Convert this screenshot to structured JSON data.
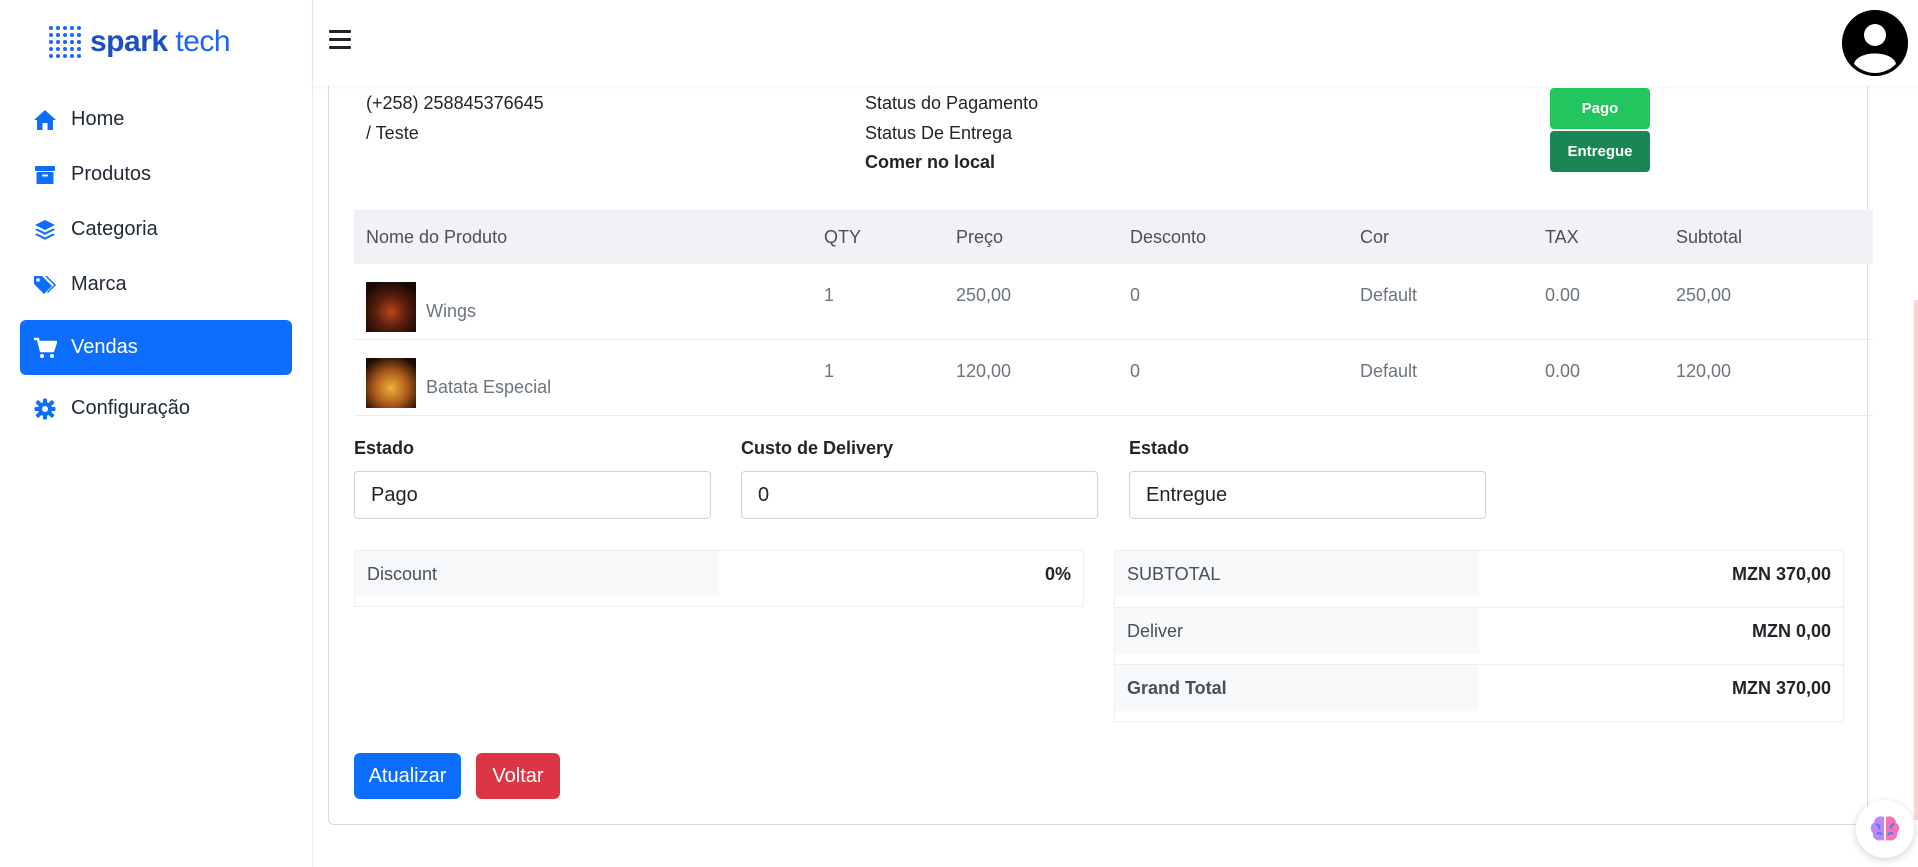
{
  "brand": {
    "name_bold": "spark",
    "name_light": " tech",
    "color": "#1a66f5"
  },
  "sidebar": {
    "items": [
      {
        "label": "Home",
        "icon": "home-icon"
      },
      {
        "label": "Produtos",
        "icon": "archive-icon"
      },
      {
        "label": "Categoria",
        "icon": "layers-icon"
      },
      {
        "label": "Marca",
        "icon": "tags-icon"
      },
      {
        "label": "Vendas",
        "icon": "cart-icon",
        "active": true
      },
      {
        "label": "Configuração",
        "icon": "gear-icon"
      }
    ]
  },
  "order": {
    "phone": "(+258) 258845376645",
    "customer": "/ Teste",
    "payment_status_label": "Status do Pagamento",
    "delivery_status_label": "Status De Entrega",
    "order_type": "Comer no local",
    "payment_badge": "Pago",
    "delivery_badge": "Entregue",
    "payment_badge_color": "#22c55e",
    "delivery_badge_color": "#198754"
  },
  "table": {
    "headers": [
      "Nome do Produto",
      "QTY",
      "Preço",
      "Desconto",
      "Cor",
      "TAX",
      "Subtotal"
    ],
    "rows": [
      {
        "name": "Wings",
        "qty": "1",
        "price": "250,00",
        "discount": "0",
        "color": "Default",
        "tax": "0.00",
        "subtotal": "250,00"
      },
      {
        "name": "Batata Especial",
        "qty": "1",
        "price": "120,00",
        "discount": "0",
        "color": "Default",
        "tax": "0.00",
        "subtotal": "120,00"
      }
    ]
  },
  "form": {
    "estado_label": "Estado",
    "estado_value": "Pago",
    "delivery_cost_label": "Custo de Delivery",
    "delivery_cost_value": "0",
    "estado2_label": "Estado",
    "estado2_value": "Entregue"
  },
  "summary": {
    "discount_label": "Discount",
    "discount_value": "0%",
    "subtotal_label": "SUBTOTAL",
    "subtotal_value": "MZN 370,00",
    "deliver_label": "Deliver",
    "deliver_value": "MZN 0,00",
    "grand_total_label": "Grand Total",
    "grand_total_value": "MZN 370,00"
  },
  "actions": {
    "update_label": "Atualizar",
    "back_label": "Voltar",
    "update_color": "#0d6efd",
    "back_color": "#dc3545"
  }
}
